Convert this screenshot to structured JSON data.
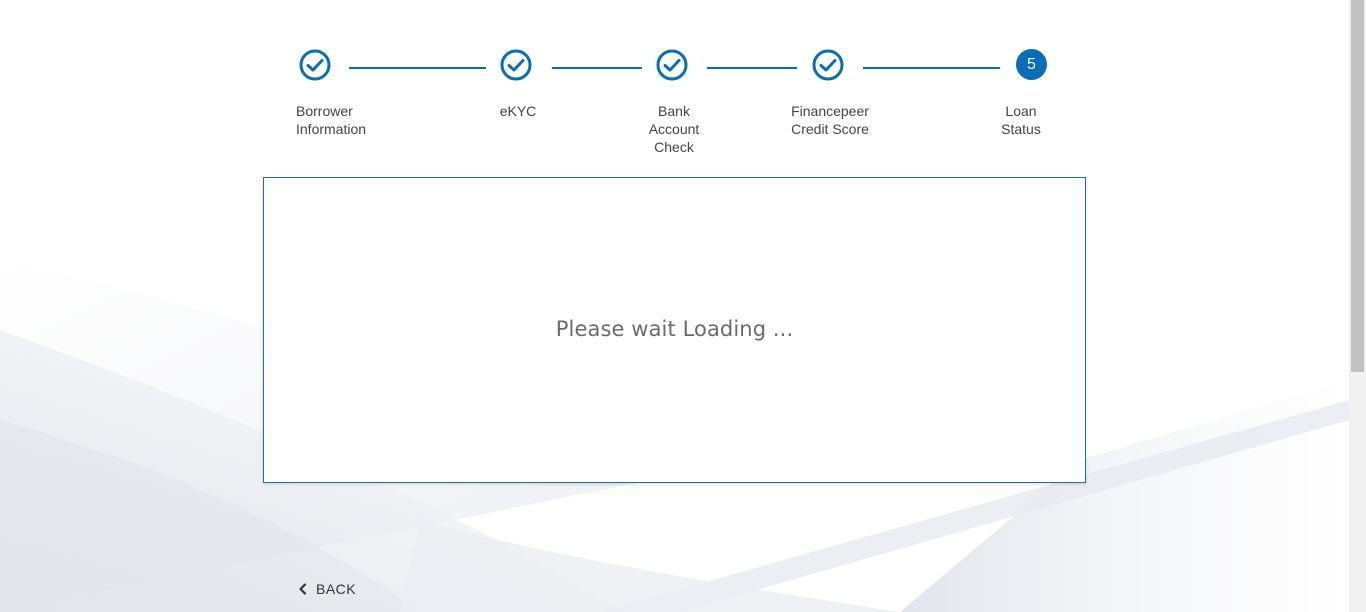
{
  "stepper": {
    "steps": [
      {
        "label": "Borrower\nInformation",
        "state": "done",
        "icon": "check-circle-icon"
      },
      {
        "label": "eKYC",
        "state": "done",
        "icon": "check-circle-icon"
      },
      {
        "label": "Bank\nAccount\nCheck",
        "state": "done",
        "icon": "check-circle-icon"
      },
      {
        "label": "Financepeer\nCredit Score",
        "state": "done",
        "icon": "check-circle-icon"
      },
      {
        "label": "Loan\nStatus",
        "state": "active",
        "number": "5"
      }
    ],
    "accent_color": "#0a6db6"
  },
  "card": {
    "loading_text": "Please wait Loading ..."
  },
  "back": {
    "label": "BACK",
    "icon": "chevron-left-icon"
  }
}
